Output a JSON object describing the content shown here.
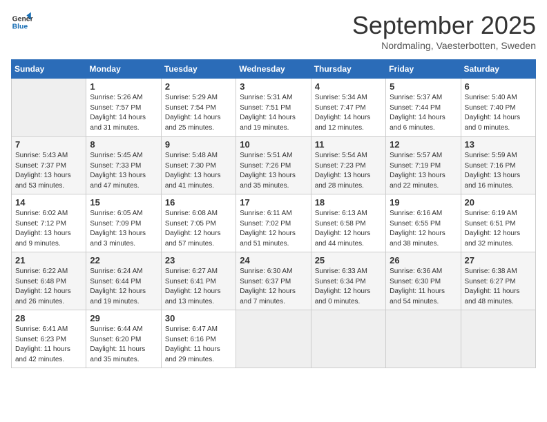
{
  "header": {
    "logo_line1": "General",
    "logo_line2": "Blue",
    "title": "September 2025",
    "subtitle": "Nordmaling, Vaesterbotten, Sweden"
  },
  "days_of_week": [
    "Sunday",
    "Monday",
    "Tuesday",
    "Wednesday",
    "Thursday",
    "Friday",
    "Saturday"
  ],
  "weeks": [
    [
      {
        "day": "",
        "info": ""
      },
      {
        "day": "1",
        "info": "Sunrise: 5:26 AM\nSunset: 7:57 PM\nDaylight: 14 hours\nand 31 minutes."
      },
      {
        "day": "2",
        "info": "Sunrise: 5:29 AM\nSunset: 7:54 PM\nDaylight: 14 hours\nand 25 minutes."
      },
      {
        "day": "3",
        "info": "Sunrise: 5:31 AM\nSunset: 7:51 PM\nDaylight: 14 hours\nand 19 minutes."
      },
      {
        "day": "4",
        "info": "Sunrise: 5:34 AM\nSunset: 7:47 PM\nDaylight: 14 hours\nand 12 minutes."
      },
      {
        "day": "5",
        "info": "Sunrise: 5:37 AM\nSunset: 7:44 PM\nDaylight: 14 hours\nand 6 minutes."
      },
      {
        "day": "6",
        "info": "Sunrise: 5:40 AM\nSunset: 7:40 PM\nDaylight: 14 hours\nand 0 minutes."
      }
    ],
    [
      {
        "day": "7",
        "info": "Sunrise: 5:43 AM\nSunset: 7:37 PM\nDaylight: 13 hours\nand 53 minutes."
      },
      {
        "day": "8",
        "info": "Sunrise: 5:45 AM\nSunset: 7:33 PM\nDaylight: 13 hours\nand 47 minutes."
      },
      {
        "day": "9",
        "info": "Sunrise: 5:48 AM\nSunset: 7:30 PM\nDaylight: 13 hours\nand 41 minutes."
      },
      {
        "day": "10",
        "info": "Sunrise: 5:51 AM\nSunset: 7:26 PM\nDaylight: 13 hours\nand 35 minutes."
      },
      {
        "day": "11",
        "info": "Sunrise: 5:54 AM\nSunset: 7:23 PM\nDaylight: 13 hours\nand 28 minutes."
      },
      {
        "day": "12",
        "info": "Sunrise: 5:57 AM\nSunset: 7:19 PM\nDaylight: 13 hours\nand 22 minutes."
      },
      {
        "day": "13",
        "info": "Sunrise: 5:59 AM\nSunset: 7:16 PM\nDaylight: 13 hours\nand 16 minutes."
      }
    ],
    [
      {
        "day": "14",
        "info": "Sunrise: 6:02 AM\nSunset: 7:12 PM\nDaylight: 13 hours\nand 9 minutes."
      },
      {
        "day": "15",
        "info": "Sunrise: 6:05 AM\nSunset: 7:09 PM\nDaylight: 13 hours\nand 3 minutes."
      },
      {
        "day": "16",
        "info": "Sunrise: 6:08 AM\nSunset: 7:05 PM\nDaylight: 12 hours\nand 57 minutes."
      },
      {
        "day": "17",
        "info": "Sunrise: 6:11 AM\nSunset: 7:02 PM\nDaylight: 12 hours\nand 51 minutes."
      },
      {
        "day": "18",
        "info": "Sunrise: 6:13 AM\nSunset: 6:58 PM\nDaylight: 12 hours\nand 44 minutes."
      },
      {
        "day": "19",
        "info": "Sunrise: 6:16 AM\nSunset: 6:55 PM\nDaylight: 12 hours\nand 38 minutes."
      },
      {
        "day": "20",
        "info": "Sunrise: 6:19 AM\nSunset: 6:51 PM\nDaylight: 12 hours\nand 32 minutes."
      }
    ],
    [
      {
        "day": "21",
        "info": "Sunrise: 6:22 AM\nSunset: 6:48 PM\nDaylight: 12 hours\nand 26 minutes."
      },
      {
        "day": "22",
        "info": "Sunrise: 6:24 AM\nSunset: 6:44 PM\nDaylight: 12 hours\nand 19 minutes."
      },
      {
        "day": "23",
        "info": "Sunrise: 6:27 AM\nSunset: 6:41 PM\nDaylight: 12 hours\nand 13 minutes."
      },
      {
        "day": "24",
        "info": "Sunrise: 6:30 AM\nSunset: 6:37 PM\nDaylight: 12 hours\nand 7 minutes."
      },
      {
        "day": "25",
        "info": "Sunrise: 6:33 AM\nSunset: 6:34 PM\nDaylight: 12 hours\nand 0 minutes."
      },
      {
        "day": "26",
        "info": "Sunrise: 6:36 AM\nSunset: 6:30 PM\nDaylight: 11 hours\nand 54 minutes."
      },
      {
        "day": "27",
        "info": "Sunrise: 6:38 AM\nSunset: 6:27 PM\nDaylight: 11 hours\nand 48 minutes."
      }
    ],
    [
      {
        "day": "28",
        "info": "Sunrise: 6:41 AM\nSunset: 6:23 PM\nDaylight: 11 hours\nand 42 minutes."
      },
      {
        "day": "29",
        "info": "Sunrise: 6:44 AM\nSunset: 6:20 PM\nDaylight: 11 hours\nand 35 minutes."
      },
      {
        "day": "30",
        "info": "Sunrise: 6:47 AM\nSunset: 6:16 PM\nDaylight: 11 hours\nand 29 minutes."
      },
      {
        "day": "",
        "info": ""
      },
      {
        "day": "",
        "info": ""
      },
      {
        "day": "",
        "info": ""
      },
      {
        "day": "",
        "info": ""
      }
    ]
  ]
}
